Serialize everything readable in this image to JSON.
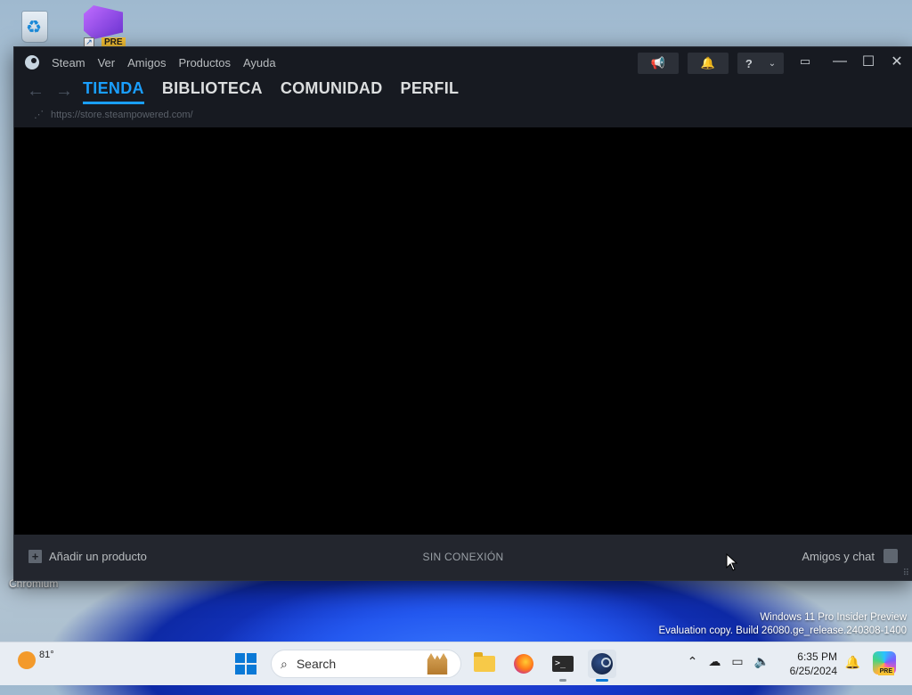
{
  "desktop": {
    "icons": [
      {
        "name": "recycle-bin"
      },
      {
        "name": "visual-studio-preview",
        "badge": "PRE"
      }
    ],
    "bottom_label": "Chromium",
    "watermark": {
      "line1": "Windows 11 Pro Insider Preview",
      "line2": "Evaluation copy. Build 26080.ge_release.240308-1400"
    }
  },
  "steam": {
    "menu": [
      "Steam",
      "Ver",
      "Amigos",
      "Productos",
      "Ayuda"
    ],
    "help_label": "?",
    "tabs": [
      {
        "label": "TIENDA",
        "active": true
      },
      {
        "label": "BIBLIOTECA",
        "active": false
      },
      {
        "label": "COMUNIDAD",
        "active": false
      },
      {
        "label": "PERFIL",
        "active": false
      }
    ],
    "url": "https://store.steampowered.com/",
    "footer": {
      "add_product": "Añadir un producto",
      "status": "SIN CONEXIÓN",
      "friends_chat": "Amigos y chat"
    },
    "colors": {
      "accent": "#1a9fff",
      "bg": "#171a21",
      "footer": "#23262e"
    }
  },
  "taskbar": {
    "weather_temp": "81°",
    "search_placeholder": "Search",
    "time": "6:35 PM",
    "date": "6/25/2024",
    "apps": [
      "start-icon",
      "file-explorer-icon",
      "firefox-icon",
      "terminal-icon",
      "steam-icon"
    ],
    "tray_icons": [
      "chevron-up-icon",
      "onedrive-offline-icon",
      "display-icon",
      "speaker-icon"
    ],
    "copilot_badge": "PRE"
  }
}
